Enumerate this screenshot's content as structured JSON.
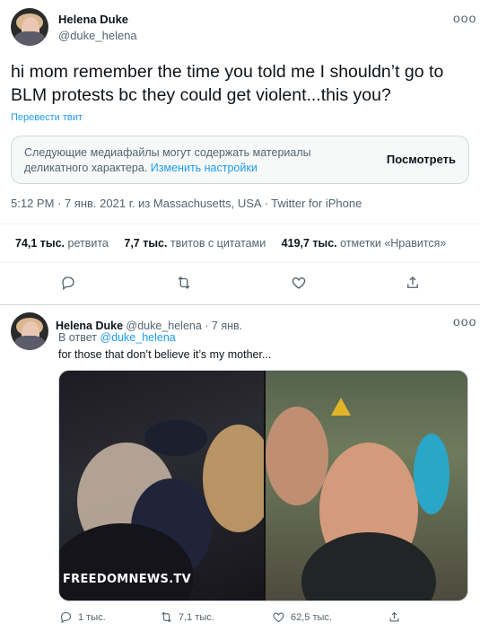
{
  "main_tweet": {
    "name": "Helena Duke",
    "handle": "@duke_helena",
    "more": "ooo",
    "text": "hi mom remember the time you told me I shouldn’t go to BLM protests bc they could get violent...this you?",
    "translate": "Перевести твит",
    "sensitive": {
      "text": "Следующие медиафайлы могут содержать материалы деликатного характера.",
      "link": "Изменить настройки",
      "button": "Посмотреть"
    },
    "timestamp": "5:12 PM · 7 янв. 2021 г. из Massachusetts, USA · Twitter for iPhone",
    "stats": {
      "retweets_count": "74,1 тыс.",
      "retweets_label": "ретвита",
      "quotes_count": "7,7 тыс.",
      "quotes_label": "твитов с цитатами",
      "likes_count": "419,7 тыс.",
      "likes_label": "отметки «Нравится»"
    }
  },
  "reply_tweet": {
    "name": "Helena Duke",
    "handle": "@duke_helena",
    "date": "· 7 янв.",
    "more": "ooo",
    "reply_prefix": "В ответ",
    "reply_handle": "@duke_helena",
    "text": "for those that don’t believe it’s my mother...",
    "watermark": "FREEDOMNEWS.TV",
    "replies": "1 тыс.",
    "retweets": "7,1 тыс.",
    "likes": "62,5 тыс."
  },
  "colors": {
    "accent": "#1d9bf0",
    "text": "#0f1419",
    "muted": "#536471",
    "border": "#cfd9de"
  },
  "icons": [
    "reply-icon",
    "retweet-icon",
    "like-icon",
    "share-icon",
    "more-icon"
  ]
}
